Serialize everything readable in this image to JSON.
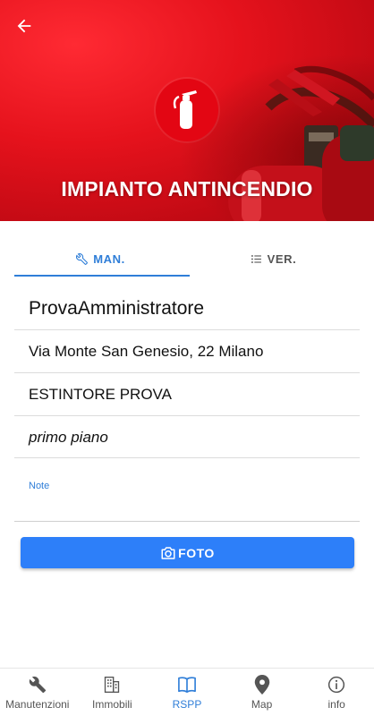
{
  "header": {
    "title": "IMPIANTO ANTINCENDIO",
    "back_icon": "arrow-left-icon",
    "category_icon": "fire-extinguisher-icon",
    "accent_color": "#e30613"
  },
  "tabs": [
    {
      "label": "MAN.",
      "icon": "wrench-icon",
      "active": true
    },
    {
      "label": "VER.",
      "icon": "list-icon",
      "active": false
    }
  ],
  "details": {
    "administrator": "ProvaAmministratore",
    "address": "Via Monte San Genesio, 22 Milano",
    "device": "ESTINTORE PROVA",
    "location": "primo piano"
  },
  "notes": {
    "label": "Note",
    "value": ""
  },
  "foto_button": {
    "label": "FOTO",
    "icon": "camera-icon",
    "color": "#2d7ff9"
  },
  "bottom_nav": [
    {
      "label": "Manutenzioni",
      "icon": "wrench-icon",
      "active": false
    },
    {
      "label": "Immobili",
      "icon": "building-icon",
      "active": false
    },
    {
      "label": "RSPP",
      "icon": "book-icon",
      "active": true
    },
    {
      "label": "Map",
      "icon": "map-marker-icon",
      "active": false
    },
    {
      "label": "info",
      "icon": "info-icon",
      "active": false
    }
  ],
  "active_color": "#2f7ed8"
}
